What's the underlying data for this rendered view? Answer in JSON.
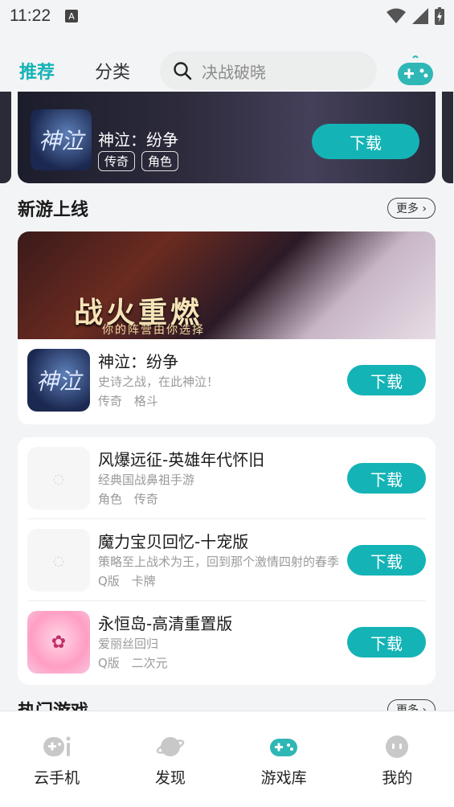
{
  "status": {
    "time": "11:22",
    "notif_letter": "A"
  },
  "nav": {
    "tabs": [
      {
        "label": "推荐",
        "active": true
      },
      {
        "label": "分类",
        "active": false
      }
    ],
    "search_placeholder": "决战破晓"
  },
  "banner": {
    "title": "神泣：纷争",
    "tags": [
      "传奇",
      "角色"
    ],
    "download": "下载",
    "icon_text": "神泣"
  },
  "new_games": {
    "title": "新游上线",
    "more": "更多",
    "feature": {
      "headline": "战火重燃",
      "sub": "你的阵营由你选择",
      "name": "神泣：纷争",
      "desc": "史诗之战，在此神泣！",
      "tags": [
        "传奇",
        "格斗"
      ],
      "download": "下载",
      "icon_text": "神泣"
    },
    "list": [
      {
        "name": "风爆远征-英雄年代怀旧",
        "desc": "经典国战鼻祖手游",
        "tags": [
          "角色",
          "传奇"
        ],
        "download": "下载"
      },
      {
        "name": "魔力宝贝回忆-十宠版",
        "desc": "策略至上战术为王，回到那个激情四射的春季",
        "tags": [
          "Q版",
          "卡牌"
        ],
        "download": "下载"
      },
      {
        "name": "永恒岛-高清重置版",
        "desc": "爱丽丝回归",
        "tags": [
          "Q版",
          "二次元"
        ],
        "download": "下载"
      }
    ]
  },
  "hot_games": {
    "title": "热门游戏",
    "more": "更多"
  },
  "bottom_nav": [
    {
      "label": "云手机",
      "icon": "cloud-phone-icon"
    },
    {
      "label": "发现",
      "icon": "planet-icon"
    },
    {
      "label": "游戏库",
      "icon": "gamepad-icon"
    },
    {
      "label": "我的",
      "icon": "profile-icon"
    }
  ],
  "colors": {
    "accent": "#14b3b6"
  }
}
